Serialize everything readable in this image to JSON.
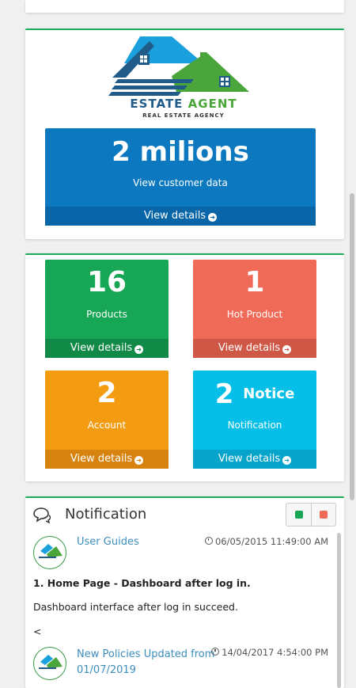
{
  "brand": {
    "logo_title_a": "ESTATE ",
    "logo_title_b": "AGENT",
    "logo_subtitle": "REAL ESTATE AGENCY",
    "colors": {
      "blue": "#215b8a",
      "green": "#4aa63a"
    }
  },
  "highlight": {
    "value": "2 milions",
    "label": "View customer data",
    "link": "View details",
    "color": "#0b78c0"
  },
  "tiles": [
    {
      "value": "16",
      "label": "Products",
      "link": "View details",
      "color": "#16a656"
    },
    {
      "value": "1",
      "label": "Hot Product",
      "link": "View details",
      "color": "#f06b57"
    },
    {
      "value": "2",
      "label": "Account",
      "link": "View details",
      "color": "#f39c12"
    },
    {
      "value": "2",
      "value_suffix": "Notice",
      "label": "Notification",
      "link": "View details",
      "color": "#06bfe8"
    }
  ],
  "notification": {
    "title": "Notification",
    "icon": "comments-icon",
    "tool_colors": [
      "#16a656",
      "#f06b57"
    ],
    "items": [
      {
        "title": "User Guides",
        "time": "06/05/2015 11:49:00 AM",
        "heading": "1. Home Page - Dashboard after log in.",
        "text": "Dashboard interface after log in succeed.",
        "more": "<"
      },
      {
        "title": "New Policies Updated from 01/07/2019",
        "time": "14/04/2017 4:54:00 PM"
      }
    ]
  }
}
